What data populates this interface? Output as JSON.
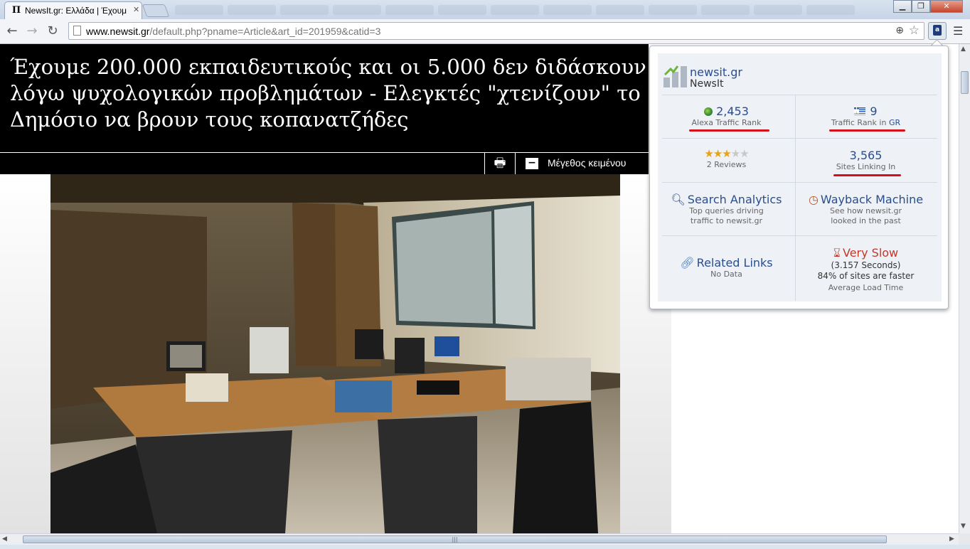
{
  "browser": {
    "tab_title": "NewsIt.gr: Ελλάδα | Έχουμ",
    "tab_favicon": "Π",
    "url_host": "www.newsit.gr",
    "url_rest": "/default.php?pname=Article&art_id=201959&catid=3",
    "icons": [
      "back-icon",
      "forward-icon",
      "reload-icon",
      "page-icon",
      "zoom-icon",
      "bookmark-star-icon",
      "alexa-extension-icon",
      "menu-icon"
    ]
  },
  "article": {
    "headline": "Έχουμε 200.000 εκπαιδευτικούς και οι 5.000 δεν διδάσκουν λόγω ψυχολογικών προβλημάτων - Ελεγκτές \"χτενίζουν\" το Δημόσιο να βρουν τους κοπανατζήδες",
    "text_size_label": "Μέγεθος κειμένου",
    "text_size_icon": "−"
  },
  "alexa": {
    "site_name": "newsit.gr",
    "site_title": "NewsIt",
    "traffic_rank": "2,453",
    "traffic_rank_label": "Alexa Traffic Rank",
    "country_rank": "9",
    "country_rank_label_prefix": "Traffic Rank in ",
    "country_code": "GR",
    "rating_stars": 3,
    "rating_max": 5,
    "reviews_label": "2 Reviews",
    "sites_linking": "3,565",
    "sites_linking_label": "Sites Linking In",
    "search_analytics_title": "Search Analytics",
    "search_analytics_desc1": "Top queries driving",
    "search_analytics_desc2": "traffic to newsit.gr",
    "wayback_title": "Wayback Machine",
    "wayback_desc1": "See how newsit.gr",
    "wayback_desc2": "looked in the past",
    "related_title": "Related Links",
    "related_desc": "No Data",
    "speed_title": "Very Slow",
    "speed_seconds": "(3.157 Seconds)",
    "speed_compare": "84% of sites are faster",
    "speed_label": "Average Load Time",
    "underline_color": "#d4101a"
  }
}
